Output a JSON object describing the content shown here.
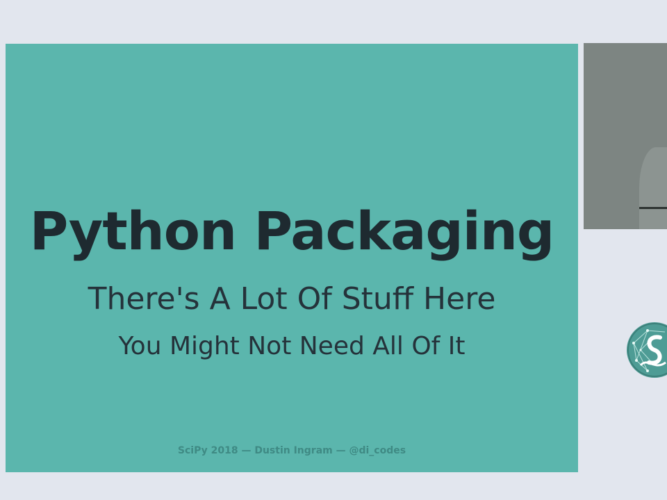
{
  "slide": {
    "title": "Python Packaging",
    "subtitle": "There's A Lot Of Stuff Here",
    "tagline": "You Might Not Need All Of It",
    "footer": "SciPy 2018 — Dustin Ingram — @di_codes"
  },
  "colors": {
    "slide_background": "#5bb6ad",
    "title_text": "#1e2a30",
    "footer_text": "#3f8a84",
    "page_background": "#e2e6ee",
    "camera_feed": "#7d8582"
  },
  "icons": {
    "conference_logo": "scipy-logo-icon"
  }
}
